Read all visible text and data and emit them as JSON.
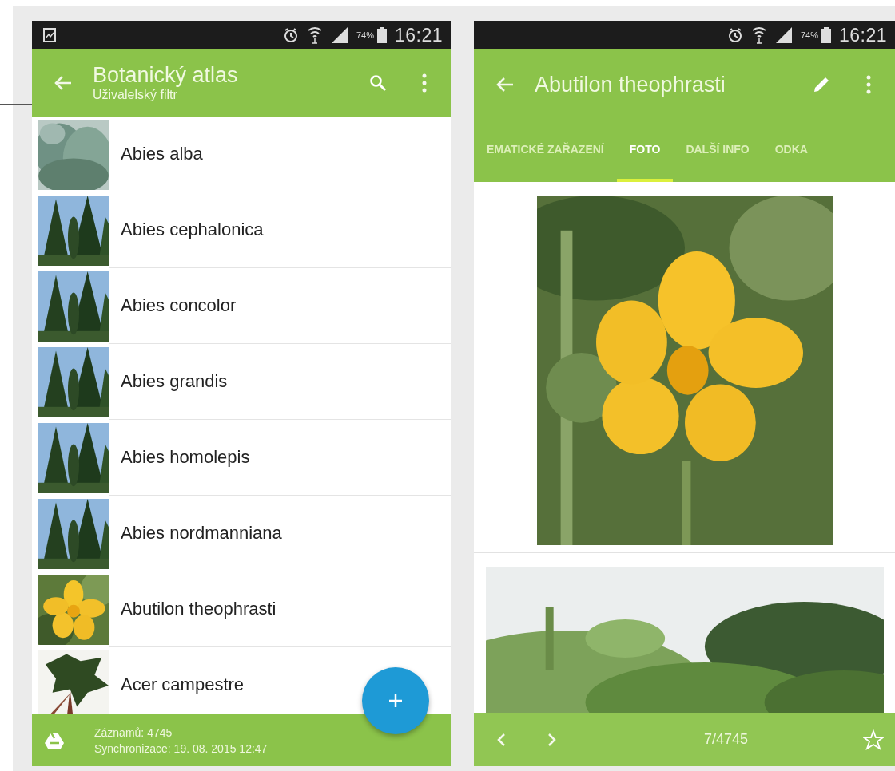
{
  "list_screen": {
    "status_bar": {
      "battery": "74%",
      "time": "16:21"
    },
    "app_bar": {
      "title": "Botanický atlas",
      "subtitle": "Uživalelský filtr"
    },
    "plants": [
      {
        "name": "Abies alba"
      },
      {
        "name": "Abies cephalonica"
      },
      {
        "name": "Abies concolor"
      },
      {
        "name": "Abies grandis"
      },
      {
        "name": "Abies homolepis"
      },
      {
        "name": "Abies nordmanniana"
      },
      {
        "name": "Abutilon theophrasti"
      },
      {
        "name": "Acer campestre"
      }
    ],
    "footer": {
      "records": "Záznamů: 4745",
      "sync": "Synchronizace: 19. 08. 2015 12:47"
    }
  },
  "detail_screen": {
    "status_bar": {
      "battery": "74%",
      "time": "16:21"
    },
    "app_bar": {
      "title": "Abutilon theophrasti"
    },
    "tabs": [
      {
        "label": "EMATICKÉ ZAŘAZENÍ",
        "selected": false
      },
      {
        "label": "FOTO",
        "selected": true
      },
      {
        "label": "DALŠÍ INFO",
        "selected": false
      },
      {
        "label": "ODKA",
        "selected": false
      }
    ],
    "pager": {
      "position": "7/4745",
      "starred": false
    }
  }
}
